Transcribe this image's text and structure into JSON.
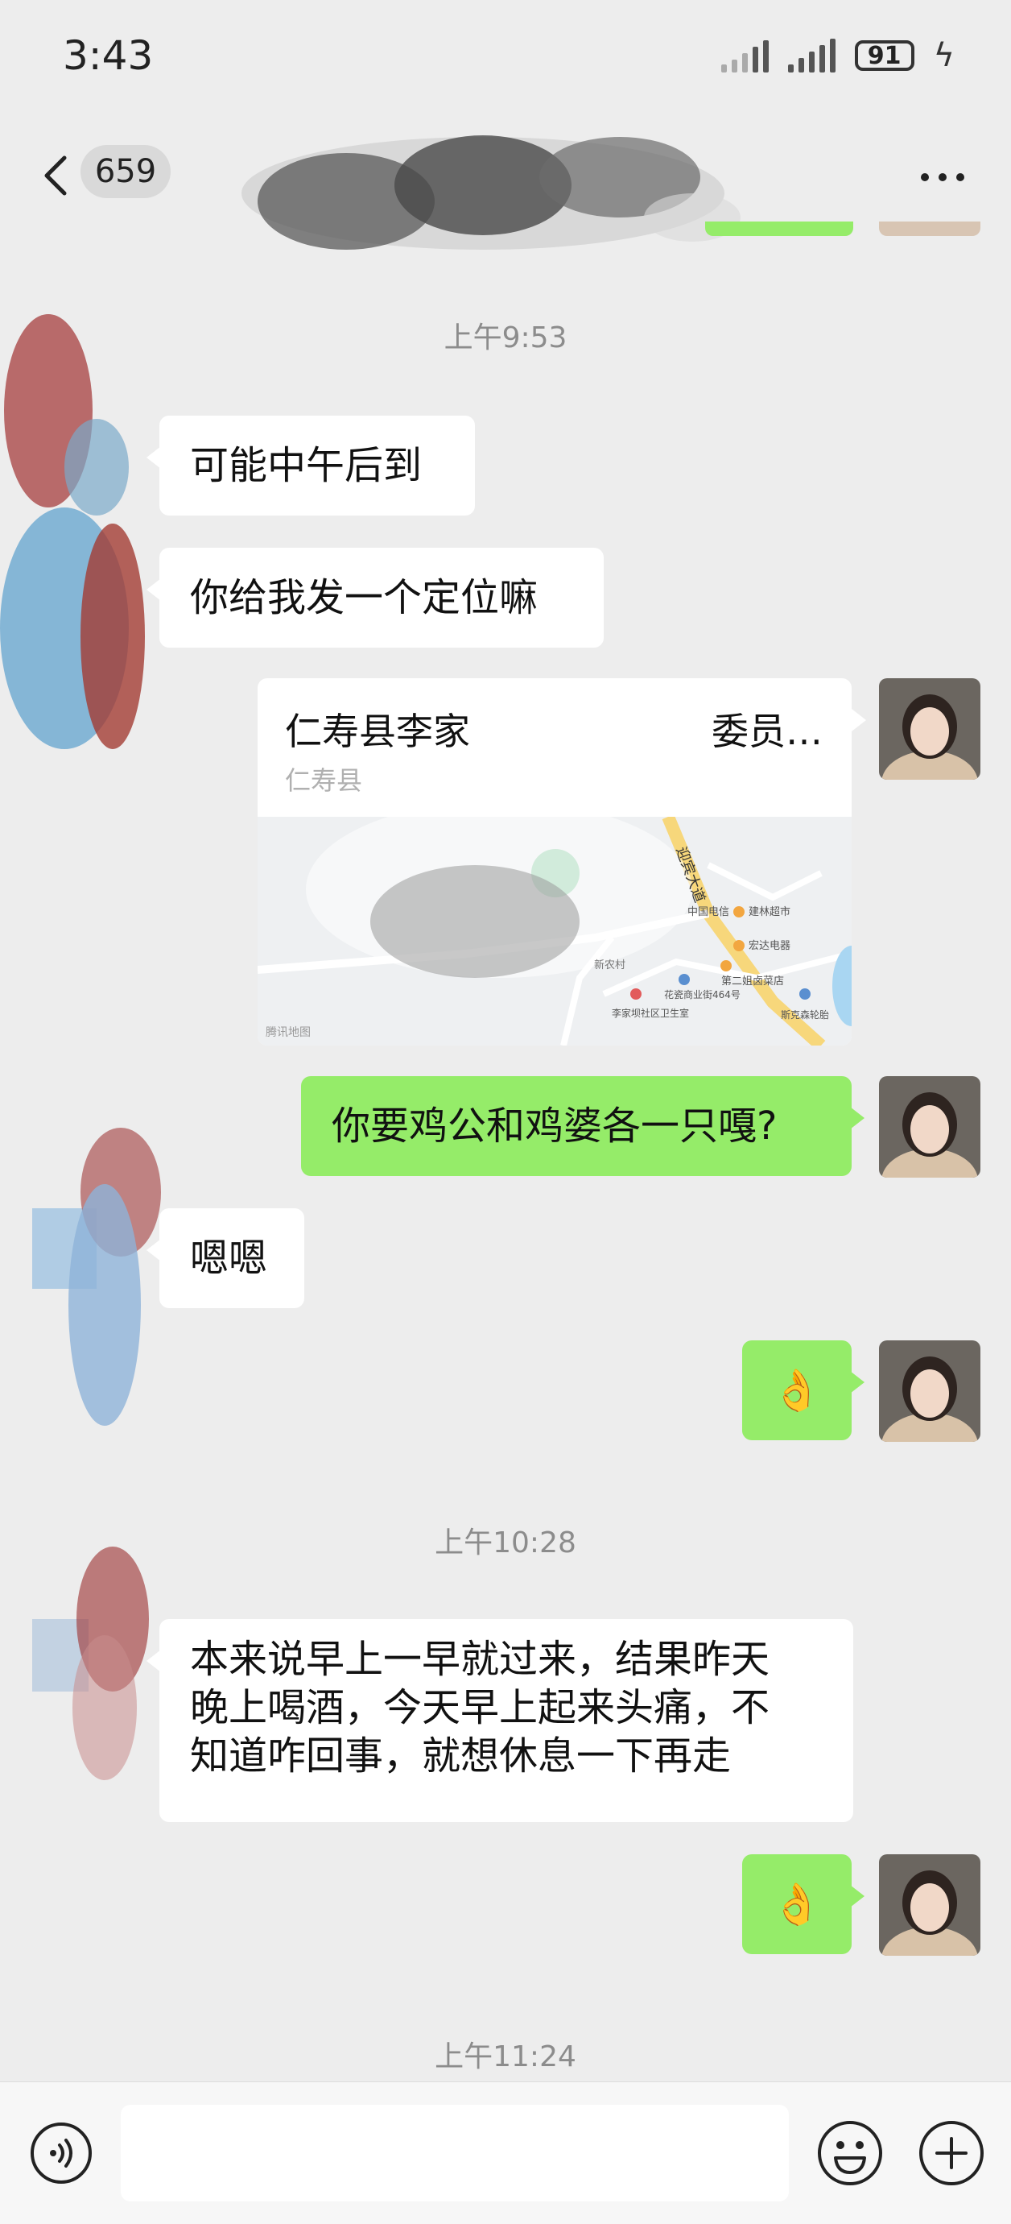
{
  "status_bar": {
    "time": "3:43",
    "battery": "91"
  },
  "header": {
    "unread_count": "659"
  },
  "timestamps": [
    "上午9:53",
    "上午10:28",
    "上午11:24"
  ],
  "messages": [
    {
      "side": "left",
      "text": "可能中午后到"
    },
    {
      "side": "left",
      "text": "你给我发一个定位嘛"
    },
    {
      "side": "right",
      "type": "location",
      "title": "仁寿县李家",
      "title_end": "委员…",
      "subtitle": "仁寿县",
      "map_labels": [
        "迎宾大道",
        "中国电信",
        "建林超市",
        "宏达电器",
        "第二姐卤菜店",
        "新农村",
        "花瓷商业街464号",
        "李家坝社区卫生室",
        "斯克森轮胎",
        "腾讯地图"
      ]
    },
    {
      "side": "right",
      "text": "你要鸡公和鸡婆各一只嘎?"
    },
    {
      "side": "left",
      "text": "嗯嗯"
    },
    {
      "side": "right",
      "text": "👌"
    },
    {
      "side": "left",
      "lines": [
        "本来说早上一早就过来，结果昨天",
        "晚上喝酒，今天早上起来头痛，不",
        "知道咋回事，就想休息一下再走"
      ]
    },
    {
      "side": "right",
      "text": "👌"
    }
  ],
  "colors": {
    "background": "#ededed",
    "bubble_self": "#95ec69",
    "bubble_other": "#ffffff"
  },
  "icons": [
    "back-icon",
    "more-icon",
    "voice-icon",
    "emoji-icon",
    "plus-icon"
  ]
}
